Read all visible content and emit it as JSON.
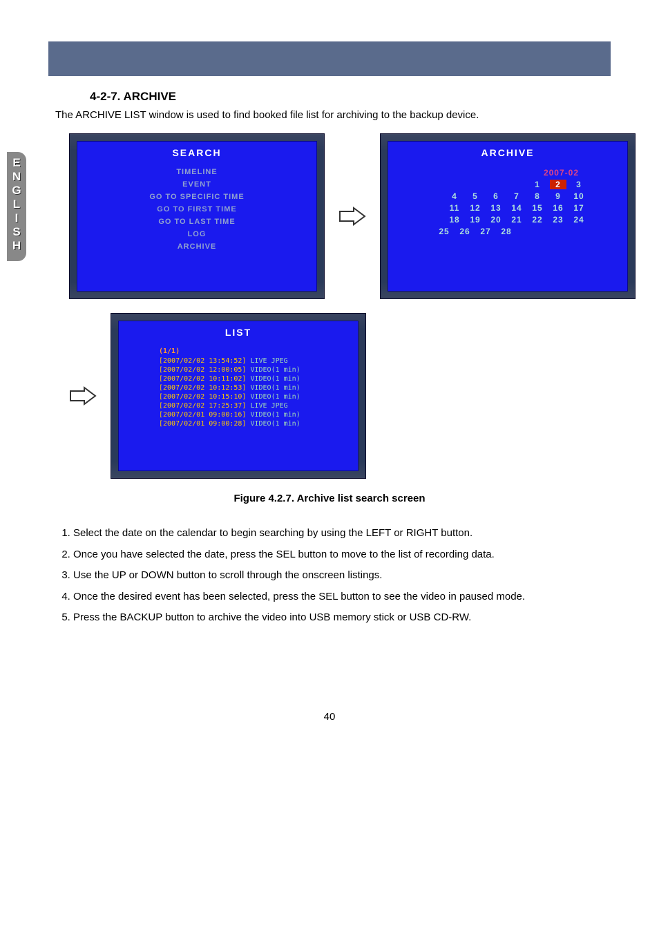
{
  "lang_tab": [
    "E",
    "N",
    "G",
    "L",
    "I",
    "S",
    "H"
  ],
  "section_title": "4-2-7. ARCHIVE",
  "intro": "The ARCHIVE LIST window is used to find booked file list for archiving to the backup device.",
  "screens": {
    "search": {
      "title": "SEARCH",
      "items": [
        "TIMELINE",
        "EVENT",
        "GO TO SPECIFIC TIME",
        "GO TO FIRST TIME",
        "GO TO LAST TIME",
        "LOG",
        "ARCHIVE"
      ]
    },
    "archive": {
      "title": "ARCHIVE",
      "month": "2007-02",
      "rows": [
        [
          "",
          "",
          "",
          "",
          "1",
          "2",
          "3"
        ],
        [
          "4",
          "5",
          "6",
          "7",
          "8",
          "9",
          "10"
        ],
        [
          "11",
          "12",
          "13",
          "14",
          "15",
          "16",
          "17"
        ],
        [
          "18",
          "19",
          "20",
          "21",
          "22",
          "23",
          "24"
        ],
        [
          "25",
          "26",
          "27",
          "28",
          "",
          "",
          ""
        ]
      ],
      "selected": "2"
    },
    "list": {
      "title": "LIST",
      "page": "(1/1)",
      "rows": [
        {
          "ts": "[2007/02/02 13:54:52]",
          "desc": "LIVE JPEG"
        },
        {
          "ts": "[2007/02/02 12:00:05]",
          "desc": "VIDEO(1 min)"
        },
        {
          "ts": "[2007/02/02 10:11:02]",
          "desc": "VIDEO(1 min)"
        },
        {
          "ts": "[2007/02/02 10:12:53]",
          "desc": "VIDEO(1 min)"
        },
        {
          "ts": "[2007/02/02 10:15:10]",
          "desc": "VIDEO(1 min)"
        },
        {
          "ts": "[2007/02/02 17:25:37]",
          "desc": "LIVE JPEG"
        },
        {
          "ts": "[2007/02/01 09:00:16]",
          "desc": "VIDEO(1 min)"
        },
        {
          "ts": "[2007/02/01 09:00:28]",
          "desc": "VIDEO(1 min)"
        }
      ]
    }
  },
  "caption": "Figure 4.2.7. Archive list search screen",
  "instructions": [
    "Select the date on the calendar to begin searching by using the LEFT or RIGHT button.",
    "Once you have selected the date, press the SEL button to move to the list of recording data.",
    "Use the UP or DOWN button to scroll through the onscreen listings.",
    "Once the desired event has been selected, press the SEL button to see the video in paused mode.",
    "Press the BACKUP button to archive the video into USB memory stick or USB CD-RW."
  ],
  "page_number": "40"
}
